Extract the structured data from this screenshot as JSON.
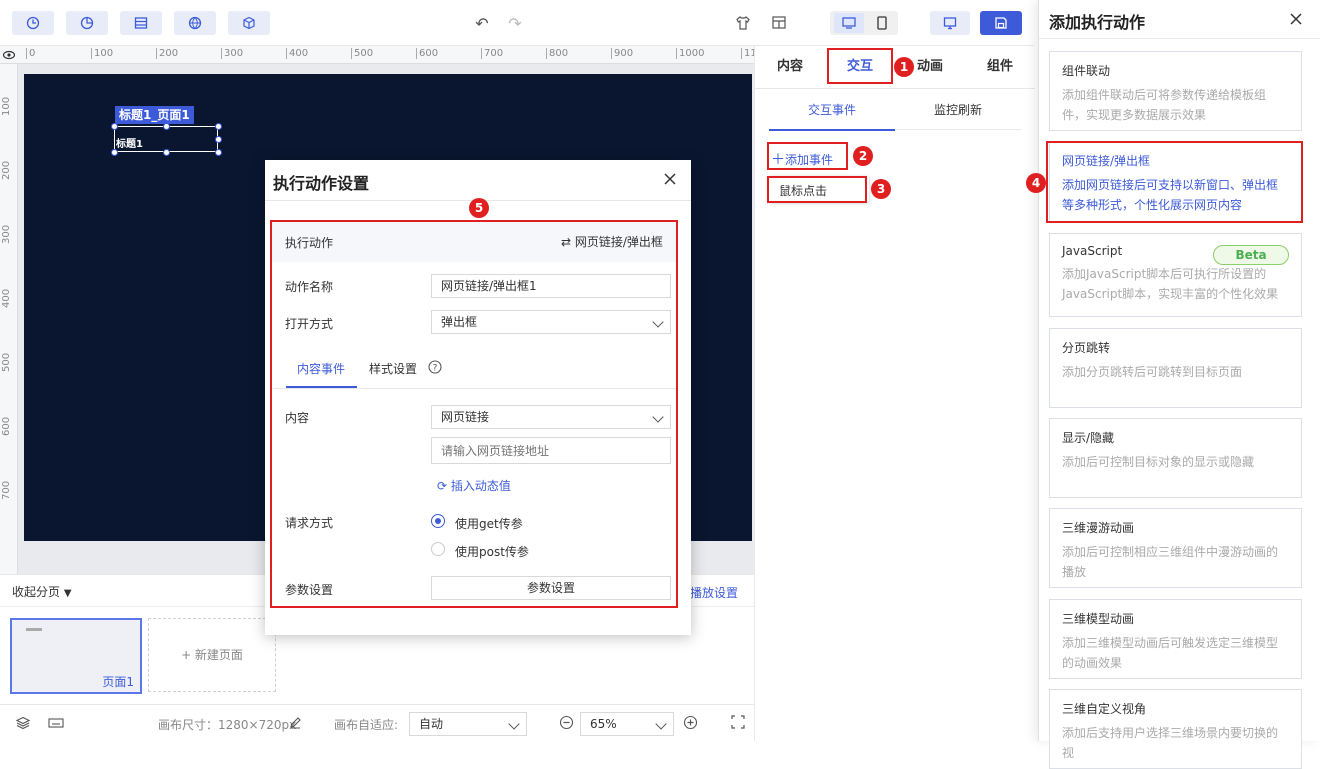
{
  "toolbar": {
    "icons": [
      "pie-chart-icon",
      "table-icon",
      "globe-icon",
      "cube-icon",
      "archive-icon"
    ],
    "undo": "↶",
    "redo": "↷"
  },
  "ruler": {
    "h_ticks": [
      "0",
      "100",
      "200",
      "300",
      "400",
      "500",
      "600",
      "700",
      "800",
      "900",
      "1000",
      "11"
    ],
    "v_ticks": [
      "100",
      "200",
      "300",
      "400",
      "500",
      "600",
      "700"
    ]
  },
  "canvas": {
    "selected_tag": "标题1_页面1",
    "selected_text": "标题1"
  },
  "pages": {
    "collapse_label": "收起分页",
    "page1_label": "页面1",
    "new_page_label": "+ 新建页面",
    "playback_label": "播放设置"
  },
  "status": {
    "canvas_size_label": "画布尺寸：1280×720px",
    "fit_label": "画布自适应:",
    "fit_value": "自动",
    "zoom_value": "65%"
  },
  "right_panel": {
    "tabs": [
      "内容",
      "交互",
      "动画",
      "组件"
    ],
    "subtabs": [
      "交互事件",
      "监控刷新"
    ],
    "add_event": "添加事件",
    "event_item": "鼠标点击"
  },
  "dialog": {
    "title": "执行动作设置",
    "action_label": "执行动作",
    "action_value": "网页链接/弹出框",
    "name_label": "动作名称",
    "name_value": "网页链接/弹出框1",
    "open_label": "打开方式",
    "open_value": "弹出框",
    "tab_content": "内容事件",
    "tab_style": "样式设置",
    "content_label": "内容",
    "content_value": "网页链接",
    "url_placeholder": "请输入网页链接地址",
    "insert_dynamic": "插入动态值",
    "request_label": "请求方式",
    "get_label": "使用get传参",
    "post_label": "使用post传参",
    "param_label": "参数设置",
    "param_button": "参数设置"
  },
  "drawer": {
    "title": "添加执行动作",
    "beta": "Beta",
    "cards": [
      {
        "title": "组件联动",
        "desc": "添加组件联动后可将参数传递给模板组件，实现更多数据展示效果"
      },
      {
        "title": "网页链接/弹出框",
        "desc": "添加网页链接后可支持以新窗口、弹出框等多种形式，个性化展示网页内容"
      },
      {
        "title": "JavaScript",
        "desc": "添加JavaScript脚本后可执行所设置的JavaScript脚本，实现丰富的个性化效果"
      },
      {
        "title": "分页跳转",
        "desc": "添加分页跳转后可跳转到目标页面"
      },
      {
        "title": "显示/隐藏",
        "desc": "添加后可控制目标对象的显示或隐藏"
      },
      {
        "title": "三维漫游动画",
        "desc": "添加后可控制相应三维组件中漫游动画的播放"
      },
      {
        "title": "三维模型动画",
        "desc": "添加三维模型动画后可触发选定三维模型的动画效果"
      },
      {
        "title": "三维自定义视角",
        "desc": "添加后支持用户选择三维场景内要切换的视"
      }
    ]
  },
  "badges": [
    "1",
    "2",
    "3",
    "4",
    "5"
  ],
  "colors": {
    "accent": "#3d5bd9",
    "annotation": "#e02020",
    "canvas": "#0a1630"
  }
}
